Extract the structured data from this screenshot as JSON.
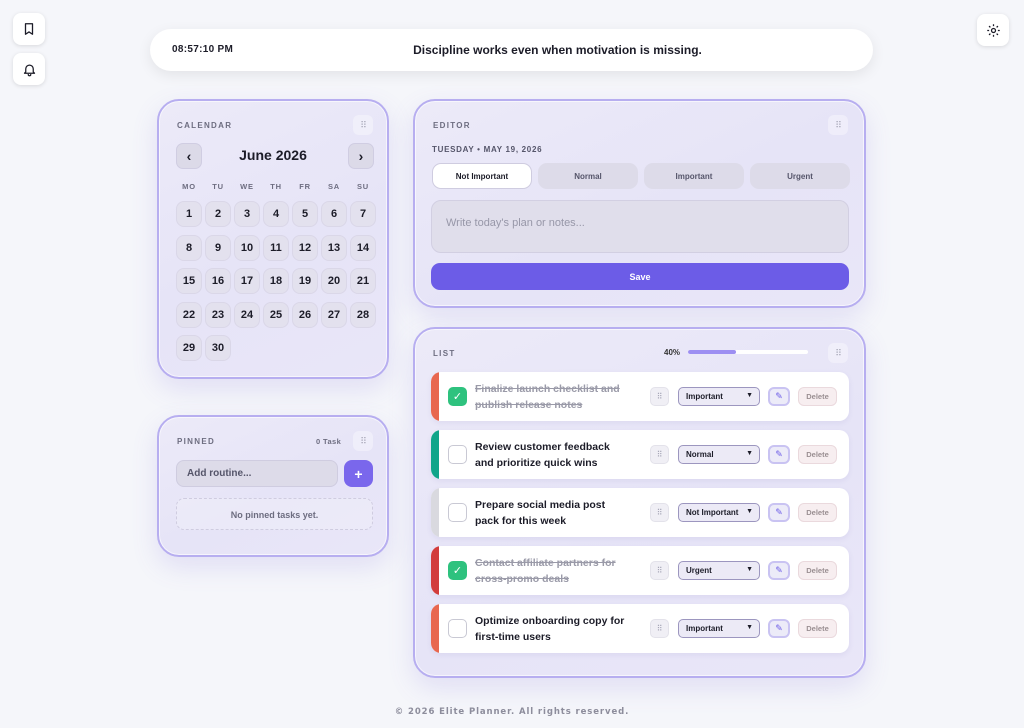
{
  "topbar": {
    "clock": "08:57:10 PM",
    "quote": "Discipline works even when motivation is missing."
  },
  "icons": {
    "bookmark": "bookmark-icon",
    "bell": "bell-icon",
    "settings": "gear-icon"
  },
  "calendar": {
    "title": "CALENDAR",
    "month": "June 2026",
    "prev": "‹",
    "next": "›",
    "weekdays": [
      "MO",
      "TU",
      "WE",
      "TH",
      "FR",
      "SA",
      "SU"
    ],
    "days": [
      "1",
      "2",
      "3",
      "4",
      "5",
      "6",
      "7",
      "8",
      "9",
      "10",
      "11",
      "12",
      "13",
      "14",
      "15",
      "16",
      "17",
      "18",
      "19",
      "20",
      "21",
      "22",
      "23",
      "24",
      "25",
      "26",
      "27",
      "28",
      "29",
      "30"
    ]
  },
  "pinned": {
    "title": "PINNED",
    "count": "0 Task",
    "input_placeholder": "Add routine...",
    "add_label": "+",
    "empty_text": "No pinned tasks yet."
  },
  "editor": {
    "title": "EDITOR",
    "date": "TUESDAY • MAY 19, 2026",
    "priorities": [
      "Not Important",
      "Normal",
      "Important",
      "Urgent"
    ],
    "selected_priority": "Not Important",
    "notes_placeholder": "Write today's plan or notes...",
    "save_label": "Save"
  },
  "list": {
    "title": "LIST",
    "progress_label": "40%",
    "progress": 0.4,
    "delete_label": "Delete",
    "edit_label": "✎",
    "tasks": [
      {
        "text": "Finalize launch checklist and publish release notes",
        "done": true,
        "priority": "Important",
        "color": "#e8674f"
      },
      {
        "text": "Review customer feedback and prioritize quick wins",
        "done": false,
        "priority": "Normal",
        "color": "#10a58a"
      },
      {
        "text": "Prepare social media post pack for this week",
        "done": false,
        "priority": "Not Important",
        "color": "#d9d9df"
      },
      {
        "text": "Contact affiliate partners for cross-promo deals",
        "done": true,
        "priority": "Urgent",
        "color": "#d23c3c"
      },
      {
        "text": "Optimize onboarding copy for first-time users",
        "done": false,
        "priority": "Important",
        "color": "#e8674f"
      }
    ]
  },
  "footer": "© 2026 Elite Planner. All rights reserved."
}
